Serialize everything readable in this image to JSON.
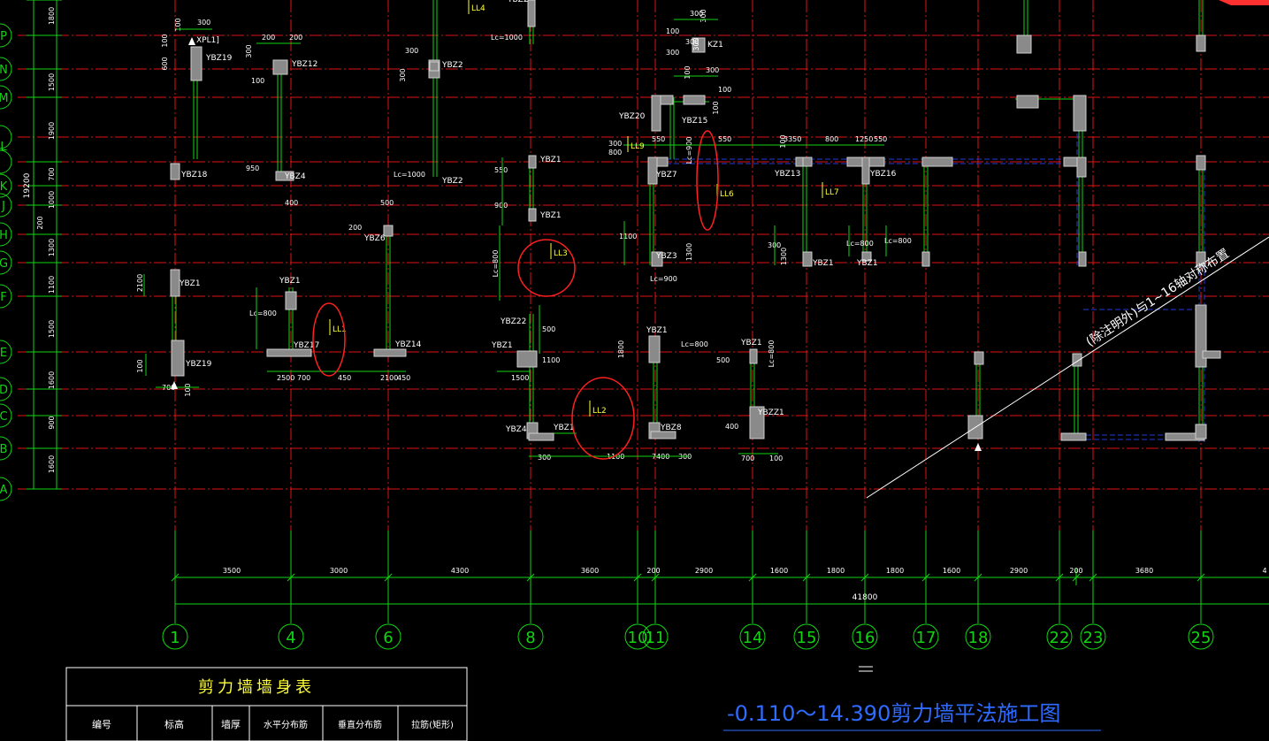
{
  "colors": {
    "background": "#000000",
    "axis_line": "#e01414",
    "dimension": "#12d412",
    "wall": "#cfcfcf",
    "wall_fill": "#8a8a8a",
    "label": "#ffffff",
    "link_beam": "#ffff33",
    "highlight": "#ff2020",
    "beam": "#1f3bd8",
    "title": "#2f6bff",
    "table_title": "#ffff33"
  },
  "title": "-0.110～14.390剪力墙平法施工图",
  "diagonal_note": "(除注明外)与1~16轴对称布置",
  "table": {
    "title": "剪力墙墙身表",
    "headers": [
      "编号",
      "标高",
      "墙厚",
      "水平分布筋",
      "垂直分布筋",
      "拉筋(矩形)"
    ]
  },
  "axes_bottom": [
    "1",
    "4",
    "6",
    "8",
    "10",
    "11",
    "14",
    "15",
    "16",
    "17",
    "18",
    "22",
    "23",
    "25"
  ],
  "axes_left": [
    "P",
    "N",
    "M",
    "L",
    "K",
    "J",
    "H",
    "G",
    "F",
    "E",
    "D",
    "C",
    "B",
    "A"
  ],
  "bottom_dims": [
    "3500",
    "3000",
    "4300",
    "3600",
    "200",
    "2900",
    "1600",
    "1800",
    "1800",
    "1600",
    "2900",
    "200",
    "3680",
    "4"
  ],
  "total_dim": "41800",
  "left_dims": [
    "1800",
    "1500",
    "1900",
    "700",
    "1000",
    "1300",
    "1100",
    "1500",
    "1600",
    "900",
    "1600"
  ],
  "left_total": "19200",
  "left_sub": "200",
  "wall_labels": [
    {
      "text": "YBZ19"
    },
    {
      "text": "YBZ12"
    },
    {
      "text": "YBZ2"
    },
    {
      "text": "YBZ2"
    },
    {
      "text": "YBZ2"
    },
    {
      "text": "KZ1"
    },
    {
      "text": "YBZ18"
    },
    {
      "text": "YBZ4"
    },
    {
      "text": "YBZ20"
    },
    {
      "text": "YBZ15"
    },
    {
      "text": "YBZ1"
    },
    {
      "text": "YBZ1"
    },
    {
      "text": "YBZ7"
    },
    {
      "text": "YBZ13"
    },
    {
      "text": "YBZ16"
    },
    {
      "text": "YBZ6"
    },
    {
      "text": "YBZ3"
    },
    {
      "text": "YBZ1"
    },
    {
      "text": "YBZ1"
    },
    {
      "text": "YBZ1"
    },
    {
      "text": "YBZ1"
    },
    {
      "text": "YBZ17"
    },
    {
      "text": "YBZ14"
    },
    {
      "text": "YBZ22"
    },
    {
      "text": "YBZ1"
    },
    {
      "text": "YBZ1"
    },
    {
      "text": "YBZ1"
    },
    {
      "text": "YBZ19"
    },
    {
      "text": "YBZ4"
    },
    {
      "text": "YBZ1"
    },
    {
      "text": "YBZ8"
    },
    {
      "text": "YBZZ1"
    },
    {
      "text": "XPL1]"
    }
  ],
  "link_beams": [
    "LL4",
    "LL9",
    "LL6",
    "LL7",
    "LL3",
    "LL1",
    "LL2"
  ],
  "small_dims": [
    "100",
    "300",
    "100",
    "600",
    "200",
    "200",
    "300",
    "100",
    "300",
    "300",
    "Lc=1000",
    "300",
    "300",
    "100",
    "300",
    "100",
    "300",
    "100",
    "100",
    "300",
    "550",
    "Lc=900",
    "400",
    "Lc=1000",
    "500",
    "200",
    "800",
    "100",
    "550",
    "3350",
    "800",
    "1250",
    "550",
    "550",
    "900",
    "1100",
    "1300",
    "Lc=900",
    "300",
    "1300",
    "Lc=800",
    "Lc=800",
    "950",
    "Lc=800",
    "2100",
    "Lc=800",
    "2500",
    "700",
    "450",
    "2100",
    "450",
    "500",
    "1500",
    "1100",
    "1800",
    "Lc=800",
    "500",
    "Lc=800",
    "100",
    "700",
    "100",
    "300",
    "1100",
    "7400",
    "300",
    "400",
    "700",
    "100",
    "300",
    "300",
    "100"
  ]
}
